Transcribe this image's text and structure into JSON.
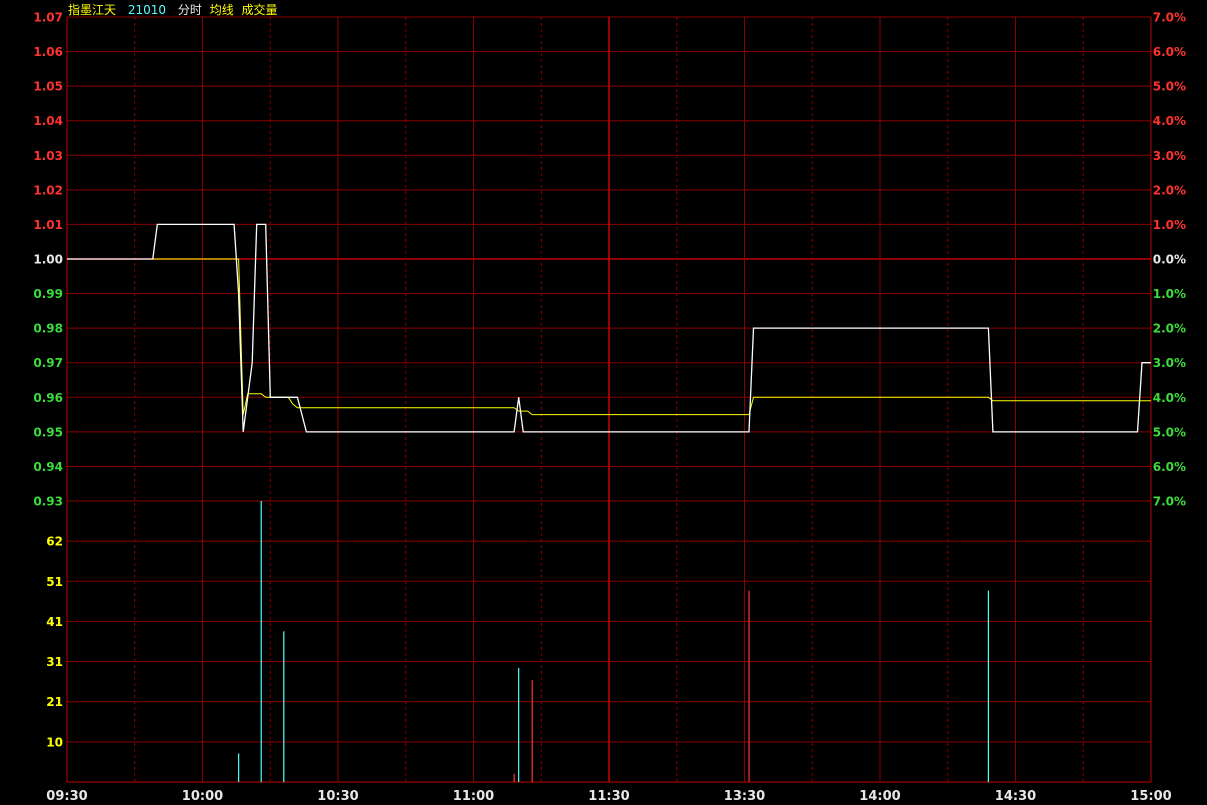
{
  "header": {
    "name": "指墨江天",
    "code": "21010",
    "mode": "分时",
    "avg_label": "均线",
    "vol_label": "成交量"
  },
  "colors": {
    "background": "#000000",
    "grid": "#8a0000",
    "grid_major": "#c00000",
    "up": "#ff3232",
    "down": "#3cdc3c",
    "neutral": "#e8e8e8",
    "price_line": "#ffffff",
    "avg_line": "#ffff00",
    "vol_down": "#54ffff",
    "vol_up": "#ff3232",
    "header_name": "#ffff00",
    "header_code": "#54ffff",
    "time_label": "#e8e8e8",
    "volume_label": "#ffff00"
  },
  "chart_data": {
    "type": "line",
    "base_price": 1.0,
    "price_ylim": [
      0.93,
      1.07
    ],
    "price_ticks": [
      "1.07",
      "1.06",
      "1.05",
      "1.04",
      "1.03",
      "1.02",
      "1.01",
      "1.00",
      "0.99",
      "0.98",
      "0.97",
      "0.96",
      "0.95",
      "0.94",
      "0.93"
    ],
    "pct_ticks": [
      "7.0%",
      "6.0%",
      "5.0%",
      "4.0%",
      "3.0%",
      "2.0%",
      "1.0%",
      "0.0%",
      "1.0%",
      "2.0%",
      "3.0%",
      "4.0%",
      "5.0%",
      "6.0%",
      "7.0%"
    ],
    "volume_ticks": [
      "62",
      "51",
      "41",
      "31",
      "21",
      "10"
    ],
    "volume_ylim": [
      0,
      69
    ],
    "time_labels": [
      "09:30",
      "10:00",
      "10:30",
      "11:00",
      "11:30",
      "13:30",
      "14:00",
      "14:30",
      "15:00"
    ],
    "price_series": {
      "name": "分时",
      "points": [
        [
          0,
          1.0
        ],
        [
          19,
          1.0
        ],
        [
          20,
          1.01
        ],
        [
          37,
          1.01
        ],
        [
          38,
          0.99
        ],
        [
          39,
          0.95
        ],
        [
          40,
          0.96
        ],
        [
          41,
          0.97
        ],
        [
          42,
          1.01
        ],
        [
          43,
          1.01
        ],
        [
          44,
          1.01
        ],
        [
          45,
          0.96
        ],
        [
          46,
          0.96
        ],
        [
          47,
          0.96
        ],
        [
          48,
          0.96
        ],
        [
          49,
          0.96
        ],
        [
          50,
          0.96
        ],
        [
          51,
          0.96
        ],
        [
          52,
          0.955
        ],
        [
          53,
          0.95
        ],
        [
          99,
          0.95
        ],
        [
          100,
          0.96
        ],
        [
          101,
          0.95
        ],
        [
          102,
          0.95
        ],
        [
          120,
          0.95
        ],
        [
          151,
          0.95
        ],
        [
          152,
          0.98
        ],
        [
          204,
          0.98
        ],
        [
          205,
          0.95
        ],
        [
          237,
          0.95
        ],
        [
          238,
          0.97
        ],
        [
          240,
          0.97
        ]
      ]
    },
    "avg_series": {
      "name": "均线",
      "points": [
        [
          0,
          1.0
        ],
        [
          38,
          1.0
        ],
        [
          39,
          0.955
        ],
        [
          40,
          0.961
        ],
        [
          43,
          0.961
        ],
        [
          44,
          0.96
        ],
        [
          47,
          0.96
        ],
        [
          49,
          0.96
        ],
        [
          50,
          0.958
        ],
        [
          51,
          0.957
        ],
        [
          99,
          0.957
        ],
        [
          100,
          0.956
        ],
        [
          102,
          0.956
        ],
        [
          103,
          0.955
        ],
        [
          120,
          0.955
        ],
        [
          151,
          0.955
        ],
        [
          152,
          0.96
        ],
        [
          204,
          0.96
        ],
        [
          205,
          0.959
        ],
        [
          240,
          0.959
        ]
      ]
    },
    "volume": [
      {
        "t": 38,
        "v": 7,
        "dir": "down"
      },
      {
        "t": 43,
        "v": 69,
        "dir": "down"
      },
      {
        "t": 48,
        "v": 37,
        "dir": "down"
      },
      {
        "t": 99,
        "v": 2,
        "dir": "up"
      },
      {
        "t": 100,
        "v": 28,
        "dir": "down"
      },
      {
        "t": 103,
        "v": 25,
        "dir": "up"
      },
      {
        "t": 151,
        "v": 47,
        "dir": "up"
      },
      {
        "t": 204,
        "v": 47,
        "dir": "down"
      }
    ]
  }
}
